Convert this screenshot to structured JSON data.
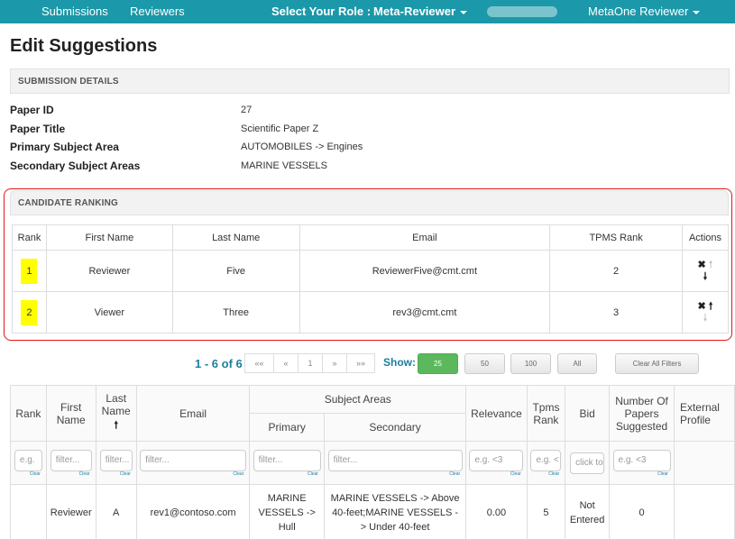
{
  "nav": {
    "submissions": "Submissions",
    "reviewers": "Reviewers",
    "role_label": "Select Your Role :",
    "role_value": "Meta-Reviewer",
    "user_menu": "MetaOne Reviewer"
  },
  "page_title": "Edit Suggestions",
  "submission": {
    "section_title": "SUBMISSION DETAILS",
    "rows": [
      {
        "label": "Paper ID",
        "value": "27"
      },
      {
        "label": "Paper Title",
        "value": "Scientific Paper Z"
      },
      {
        "label": "Primary Subject Area",
        "value": "AUTOMOBILES -> Engines"
      },
      {
        "label": "Secondary Subject Areas",
        "value": "MARINE VESSELS"
      }
    ]
  },
  "candidates": {
    "section_title": "CANDIDATE RANKING",
    "headers": [
      "Rank",
      "First Name",
      "Last Name",
      "Email",
      "TPMS Rank",
      "Actions"
    ],
    "rows": [
      {
        "rank": "1",
        "first": "Reviewer",
        "last": "Five",
        "email": "ReviewerFive@cmt.cmt",
        "tpms": "2"
      },
      {
        "rank": "2",
        "first": "Viewer",
        "last": "Three",
        "email": "rev3@cmt.cmt",
        "tpms": "3"
      }
    ],
    "highlight_color": "#ffff00"
  },
  "pagination": {
    "range": "1 - 6 of 6",
    "pages": [
      "««",
      "«",
      "1",
      "»",
      "»»"
    ],
    "show_label": "Show:",
    "sizes": [
      "25",
      "50",
      "100",
      "All"
    ],
    "active_size": "25",
    "clear_all": "Clear All Filters"
  },
  "reviewers_table": {
    "headers": {
      "rank": "Rank",
      "first_name": "First Name",
      "last_name": "Last Name",
      "email": "Email",
      "subject_areas": "Subject Areas",
      "primary": "Primary",
      "secondary": "Secondary",
      "relevance": "Relevance",
      "tpms_rank": "Tpms Rank",
      "bid": "Bid",
      "papers_suggested": "Number Of Papers Suggested",
      "external": "External Profile"
    },
    "filters": {
      "rank": "e.g.",
      "first_name": "filter...",
      "last_name": "filter...",
      "email": "filter...",
      "primary": "filter...",
      "secondary": "filter...",
      "relevance": "e.g. <3",
      "tpms": "e.g. <",
      "bid": "click to",
      "papers": "e.g. <3",
      "clear": "Clear"
    },
    "rows": [
      {
        "rank": "",
        "first": "Reviewer",
        "last": "A",
        "email": "rev1@contoso.com",
        "primary": "MARINE VESSELS -> Hull",
        "secondary": "MARINE VESSELS -> Above 40-feet;MARINE VESSELS -> Under 40-feet",
        "relevance": "0.00",
        "tpms": "5",
        "bid": "Not Entered",
        "papers": "0"
      }
    ]
  },
  "colors": {
    "nav_bg": "#1b98a9",
    "accent": "#1b7fa0",
    "highlight_border": "#e0161b",
    "active_button": "#5cb85c"
  }
}
